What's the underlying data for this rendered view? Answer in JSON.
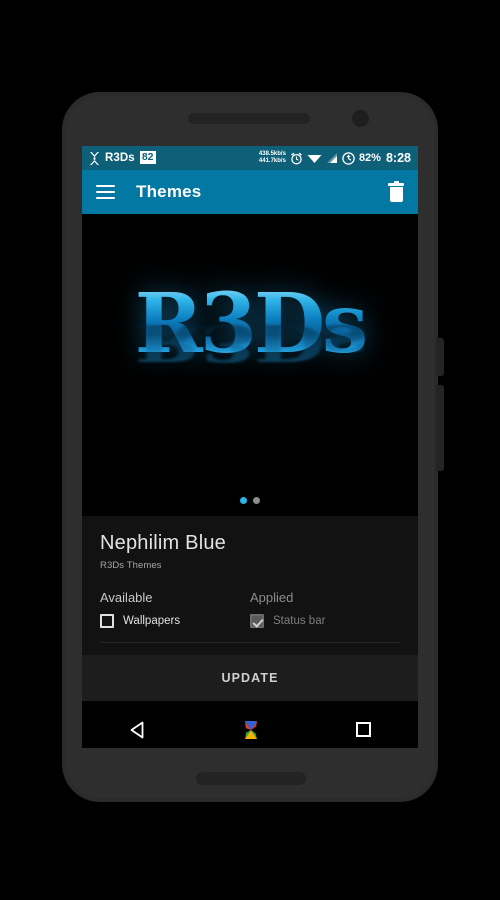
{
  "device": {
    "frame": "android-phone-mockup"
  },
  "status_bar": {
    "app_icon": "x-logo-icon",
    "app_name": "R3Ds",
    "badge": "82",
    "network_down": "438.5kb/s",
    "network_up": "441.7kb/s",
    "alarm_icon": "alarm-clock-icon",
    "wifi_icon": "wifi-icon",
    "signal_icon": "cell-signal-icon",
    "sync_icon": "sync-circle-icon",
    "battery": "82%",
    "clock": "8:28",
    "background_color": "#0e5f78",
    "text_color": "#ffffff"
  },
  "app_bar": {
    "menu_icon": "hamburger-menu-icon",
    "title": "Themes",
    "delete_icon": "trash-icon",
    "background_color": "#0278a2"
  },
  "preview": {
    "logo_text": "R3Ds",
    "carousel": {
      "total": 2,
      "active_index": 0,
      "active_color": "#29b6e8",
      "inactive_color": "#8d8d8d"
    }
  },
  "theme": {
    "name": "Nephilim Blue",
    "author": "R3Ds Themes"
  },
  "options": {
    "available": {
      "header": "Available",
      "items": [
        {
          "label": "Wallpapers",
          "checked": false,
          "disabled": false
        }
      ]
    },
    "applied": {
      "header": "Applied",
      "items": [
        {
          "label": "Status bar",
          "checked": true,
          "disabled": true
        }
      ]
    }
  },
  "actions": {
    "update_label": "UPDATE"
  },
  "nav_bar": {
    "back_icon": "back-triangle-icon",
    "home_icon": "home-colorful-icon",
    "recents_icon": "recents-square-icon"
  }
}
